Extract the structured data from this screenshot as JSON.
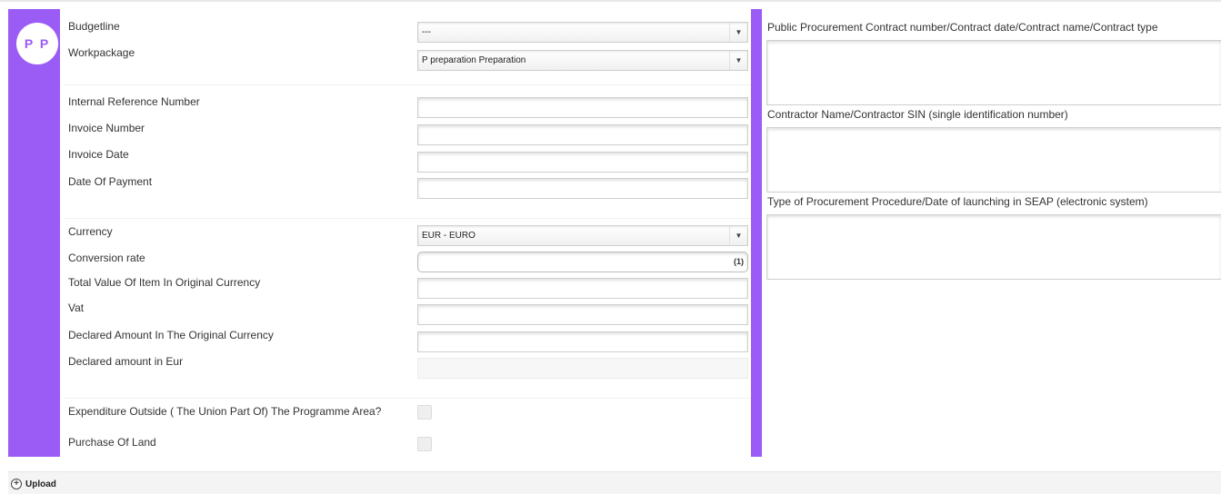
{
  "avatar": {
    "initials": "P P"
  },
  "budget": {
    "budgetline_label": "Budgetline",
    "budgetline_value": "---",
    "workpackage_label": "Workpackage",
    "workpackage_value": "P preparation Preparation"
  },
  "invoice": {
    "internal_ref_label": "Internal Reference Number",
    "invoice_number_label": "Invoice Number",
    "invoice_date_label": "Invoice Date",
    "date_of_payment_label": "Date Of Payment"
  },
  "amounts": {
    "currency_label": "Currency",
    "currency_value": "EUR - EURO",
    "conversion_rate_label": "Conversion rate",
    "conversion_rate_suffix": "(1)",
    "total_value_label": "Total Value Of Item In Original Currency",
    "vat_label": "Vat",
    "declared_original_label": "Declared Amount In The Original Currency",
    "declared_eur_label": "Declared amount in Eur"
  },
  "flags": {
    "outside_area_label": "Expenditure Outside ( The Union Part Of) The Programme Area?",
    "purchase_land_label": "Purchase Of Land"
  },
  "procurement": {
    "contract_label": "Public Procurement Contract number/Contract date/Contract name/Contract type",
    "contractor_label": "Contractor Name/Contractor SIN (single identification number)",
    "procedure_label": "Type of Procurement Procedure/Date of launching in SEAP (electronic system)"
  },
  "upload": {
    "label": "Upload"
  },
  "colors": {
    "accent": "#9b5cf6"
  }
}
